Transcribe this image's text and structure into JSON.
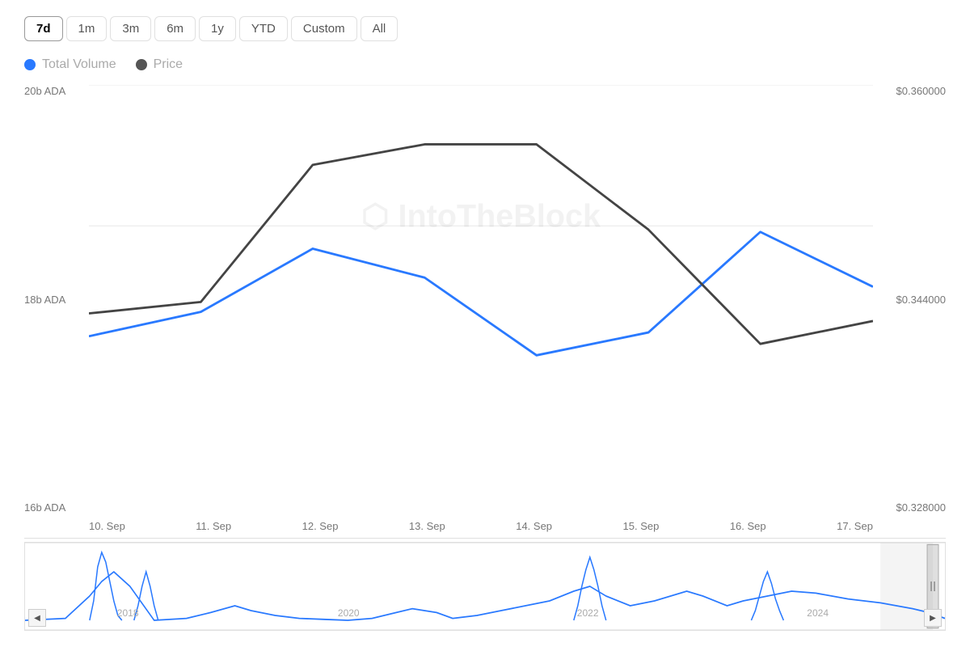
{
  "timeControls": {
    "buttons": [
      "7d",
      "1m",
      "3m",
      "6m",
      "1y",
      "YTD",
      "Custom",
      "All"
    ],
    "active": "7d"
  },
  "legend": {
    "items": [
      {
        "label": "Total Volume",
        "color": "#2979ff",
        "dotColor": "#2979ff"
      },
      {
        "label": "Price",
        "color": "#aaa",
        "dotColor": "#555"
      }
    ]
  },
  "yAxisLeft": {
    "labels": [
      "20b ADA",
      "18b ADA",
      "16b ADA"
    ]
  },
  "yAxisRight": {
    "labels": [
      "$0.360000",
      "$0.344000",
      "$0.328000"
    ]
  },
  "xAxis": {
    "labels": [
      "10. Sep",
      "11. Sep",
      "12. Sep",
      "13. Sep",
      "14. Sep",
      "15. Sep",
      "16. Sep",
      "17. Sep"
    ]
  },
  "miniChart": {
    "yearLabels": [
      {
        "year": "2018",
        "pct": 8
      },
      {
        "year": "2020",
        "pct": 34
      },
      {
        "year": "2022",
        "pct": 60
      },
      {
        "year": "2024",
        "pct": 85
      }
    ]
  },
  "watermark": {
    "text": "IntoTheBlock"
  },
  "navButtons": {
    "left": "◀",
    "right": "▶"
  }
}
